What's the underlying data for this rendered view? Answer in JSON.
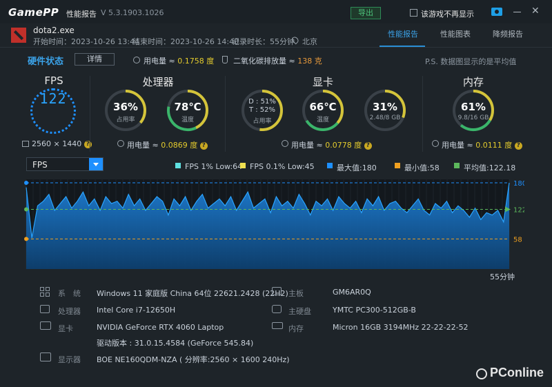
{
  "titlebar": {
    "logo": "GamePP",
    "title": "性能报告",
    "version": "V 5.3.1903.1026",
    "export_label": "导出",
    "no_show_label": "该游戏不再显示"
  },
  "session": {
    "game": "dota2.exe",
    "start": "开始时间：2023-10-26 13:44",
    "end": "结束时间：2023-10-26 14:40",
    "duration": "记录时长：55分钟",
    "location": "北京"
  },
  "tabs": [
    {
      "label": "性能报告",
      "active": true
    },
    {
      "label": "性能图表",
      "active": false
    },
    {
      "label": "降频报告",
      "active": false
    }
  ],
  "hardware": {
    "title": "硬件状态",
    "detail_label": "详情",
    "power_prefix": "用电量 ≈ ",
    "power_value": "0.1758 度",
    "co2_prefix": "二氧化碳排放量 ≈ ",
    "co2_value": "138 克",
    "note": "P.S. 数据图显示的是平均值"
  },
  "fps_panel": {
    "title": "FPS",
    "value": "122",
    "resolution": "2560 × 1440"
  },
  "cpu_panel": {
    "title": "处理器",
    "usage": "36%",
    "usage_label": "占用率",
    "usage_fraction": 0.36,
    "temp": "78℃",
    "temp_label": "温度",
    "temp_fraction": 0.78,
    "power_prefix": "用电量 ≈ ",
    "power_value": "0.0869 度"
  },
  "gpu_panel": {
    "title": "显卡",
    "d_line": "D : 51%",
    "t_line": "T : 52%",
    "usage_label": "占用率",
    "usage_fraction": 0.52,
    "temp": "66℃",
    "temp_label": "温度",
    "temp_fraction": 0.66,
    "mem": "31%",
    "mem_label": "2.48/8 GB",
    "mem_fraction": 0.31,
    "power_prefix": "用电量 ≈ ",
    "power_value": "0.0778 度"
  },
  "ram_panel": {
    "title": "内存",
    "usage": "61%",
    "usage_label": "9.8/16 GB",
    "usage_fraction": 0.61,
    "power_prefix": "用电量 ≈ ",
    "power_value": "0.0111 度"
  },
  "colors": {
    "accent": "#1e90ff",
    "gauge_track": "#3a4148",
    "gauge_yellow": "#d4c43a",
    "gauge_green": "#3ab56a"
  },
  "chart": {
    "selector": "FPS",
    "legend": [
      {
        "label": "FPS 1% Low:64",
        "color": "#5fe0e0"
      },
      {
        "label": "FPS 0.1% Low:45",
        "color": "#f0e050"
      },
      {
        "label": "最大值:180",
        "color": "#1e90ff"
      },
      {
        "label": "最小值:58",
        "color": "#f0a020"
      },
      {
        "label": "平均值:122.18",
        "color": "#5cb85c"
      }
    ],
    "max_label": "180",
    "avg_label": "122.19",
    "min_label": "58",
    "time_label": "55分钟"
  },
  "chart_data": {
    "type": "area",
    "series": [
      {
        "name": "FPS",
        "values": [
          170,
          60,
          130,
          140,
          155,
          120,
          135,
          150,
          125,
          140,
          160,
          130,
          145,
          120,
          150,
          135,
          140,
          125,
          155,
          130,
          145,
          120,
          135,
          150,
          140,
          110,
          145,
          130,
          150,
          120,
          140,
          155,
          125,
          135,
          145,
          130,
          150,
          120,
          140,
          160,
          125,
          135,
          145,
          115,
          150,
          130,
          140,
          125,
          155,
          135,
          110,
          140,
          130,
          145,
          120,
          150,
          135,
          125,
          140,
          115,
          145,
          130,
          150,
          120,
          135,
          140,
          125,
          115,
          130,
          145,
          120,
          110,
          135,
          125,
          140,
          115,
          130,
          120,
          105,
          125,
          100,
          115,
          110,
          120,
          95,
          180
        ]
      }
    ],
    "ylim": [
      0,
      180
    ],
    "max": 180,
    "min": 58,
    "avg": 122.19
  },
  "system": {
    "os_label": "系　统",
    "os": "Windows 11 家庭版 China 64位 22621.2428 (22H2)",
    "cpu_label": "处理器",
    "cpu": "Intel Core i7-12650H",
    "gpu_label": "显卡",
    "gpu": "NVIDIA GeForce RTX 4060 Laptop",
    "driver": "驱动版本 : 31.0.15.4584 (GeForce 545.84)",
    "display_label": "显示器",
    "display": "BOE NE160QDM-NZA ( 分辨率:2560 × 1600 240Hz)",
    "board_label": "主板",
    "board": "GM6AR0Q",
    "disk_label": "主硬盘",
    "disk": "YMTC PC300-512GB-B",
    "ram_label": "内存",
    "ram": "Micron 16GB 3194MHz 22-22-22-52"
  },
  "watermark": "PConline"
}
